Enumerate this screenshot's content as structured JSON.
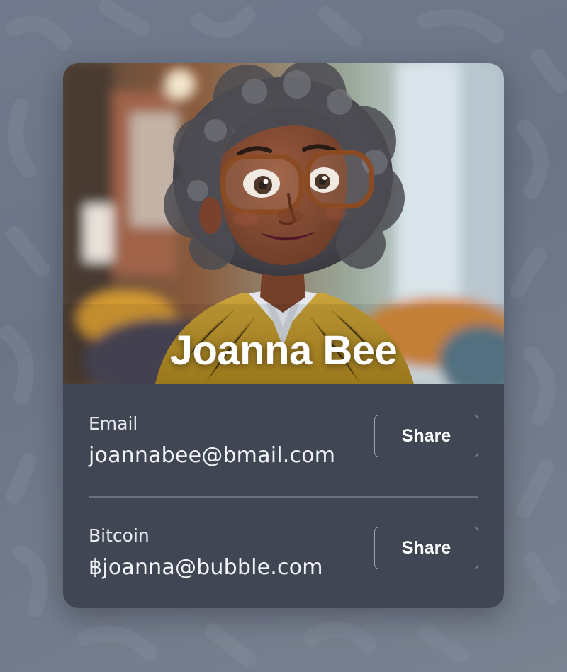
{
  "profile": {
    "name": "Joanna Bee"
  },
  "contacts": {
    "email": {
      "label": "Email",
      "value": "joannabee@bmail.com",
      "button_label": "Share"
    },
    "bitcoin": {
      "label": "Bitcoin",
      "value": "฿joanna@bubble.com",
      "button_label": "Share"
    }
  },
  "colors": {
    "card_background": "#414654",
    "page_background": "#717a8c",
    "text": "#ffffff",
    "button_border": "#9aa0ad"
  }
}
